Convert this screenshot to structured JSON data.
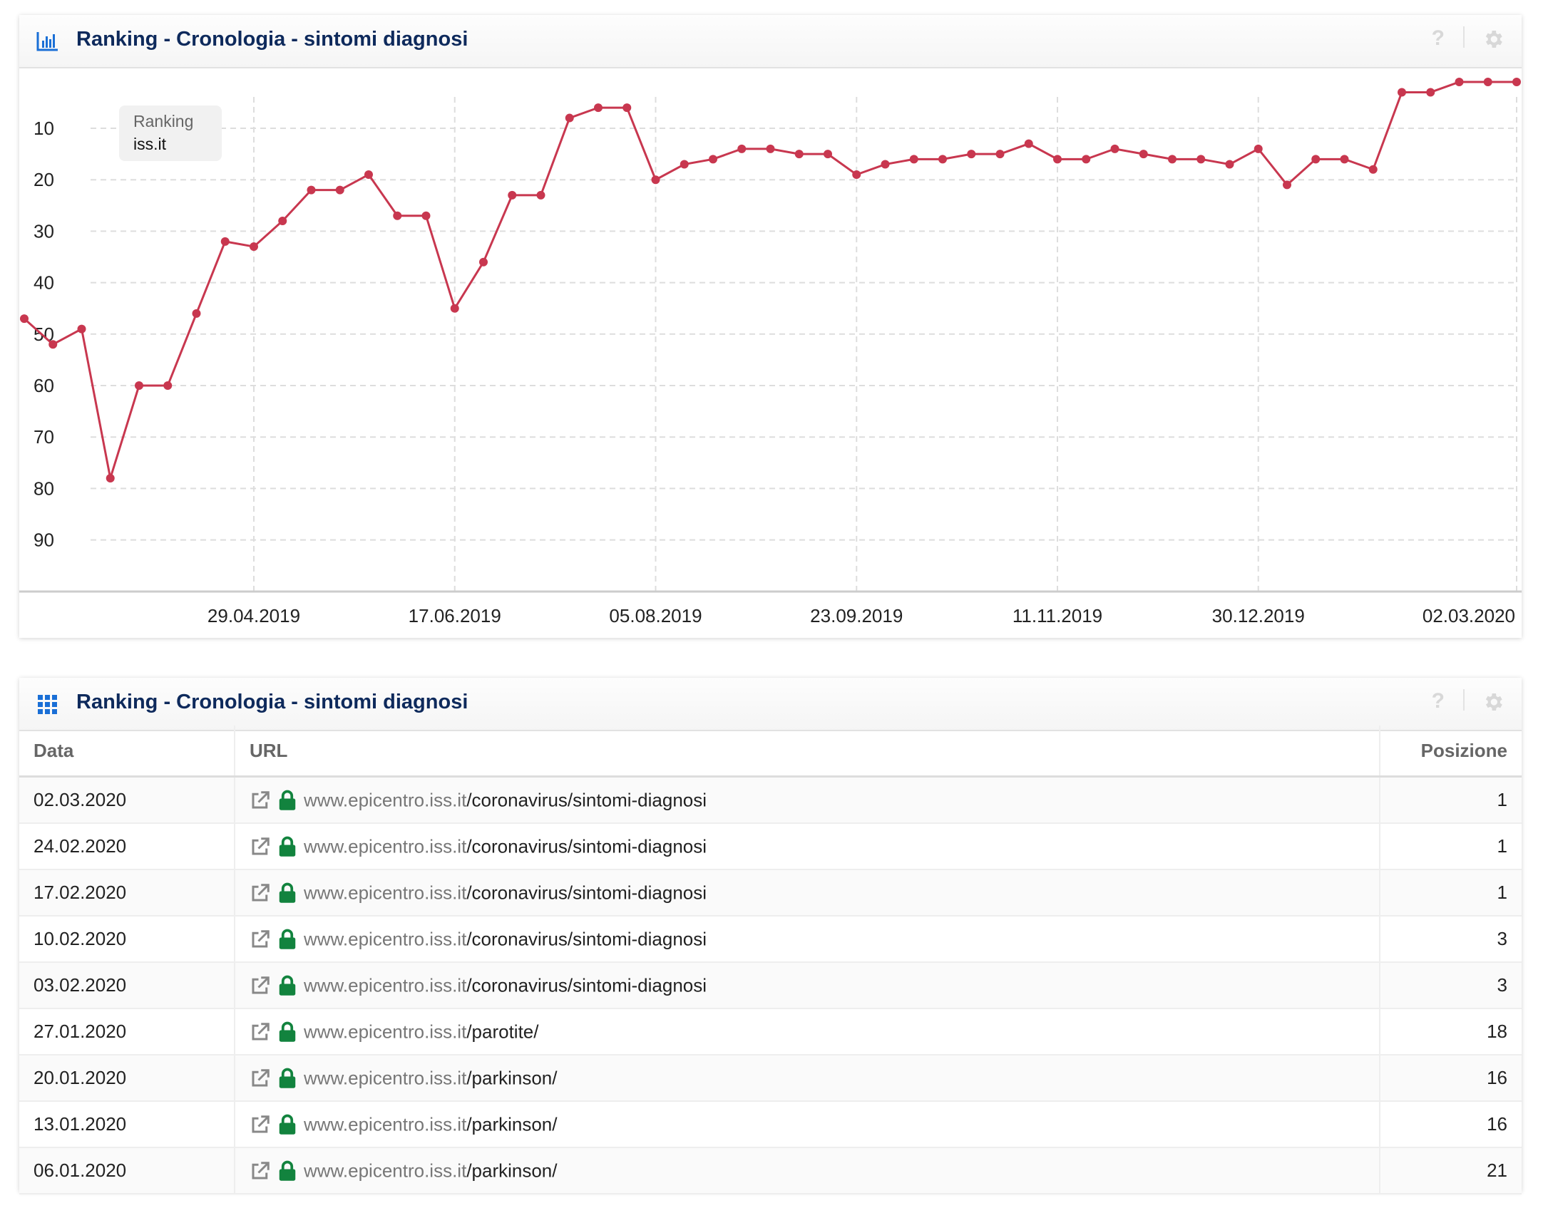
{
  "chart_panel": {
    "title": "Ranking - Cronologia - sintomi diagnosi",
    "icon": "bar-chart-icon",
    "help_label": "?",
    "legend": {
      "line1": "Ranking",
      "line2": "iss.it"
    }
  },
  "chart_data": {
    "type": "line",
    "title": "Ranking - Cronologia - sintomi diagnosi",
    "series": [
      {
        "name": "iss.it",
        "color": "#c8374f",
        "start_date": "04.03.2019",
        "interval": "weekly",
        "values": [
          47,
          52,
          49,
          78,
          60,
          60,
          46,
          32,
          33,
          28,
          22,
          22,
          19,
          27,
          27,
          45,
          36,
          23,
          23,
          8,
          6,
          6,
          20,
          17,
          16,
          14,
          14,
          15,
          15,
          19,
          17,
          16,
          16,
          15,
          15,
          13,
          16,
          16,
          14,
          15,
          16,
          16,
          17,
          14,
          21,
          16,
          16,
          18,
          3,
          3,
          1,
          1,
          1
        ]
      }
    ],
    "x_ticks": [
      "29.04.2019",
      "17.06.2019",
      "05.08.2019",
      "23.09.2019",
      "11.11.2019",
      "30.12.2019",
      "02.03.2020"
    ],
    "y_ticks": [
      10,
      20,
      30,
      40,
      50,
      60,
      70,
      80,
      90
    ],
    "ylim": [
      0,
      100
    ],
    "y_inverted": true,
    "grid": true,
    "legend_placement": "top-left"
  },
  "table_panel": {
    "title": "Ranking - Cronologia - sintomi diagnosi",
    "icon": "grid-icon",
    "help_label": "?",
    "columns": [
      "Data",
      "URL",
      "Posizione"
    ],
    "rows": [
      {
        "date": "02.03.2020",
        "host": "www.epicentro.iss.it",
        "path": "/coronavirus/sintomi-diagnosi",
        "pos": "1"
      },
      {
        "date": "24.02.2020",
        "host": "www.epicentro.iss.it",
        "path": "/coronavirus/sintomi-diagnosi",
        "pos": "1"
      },
      {
        "date": "17.02.2020",
        "host": "www.epicentro.iss.it",
        "path": "/coronavirus/sintomi-diagnosi",
        "pos": "1"
      },
      {
        "date": "10.02.2020",
        "host": "www.epicentro.iss.it",
        "path": "/coronavirus/sintomi-diagnosi",
        "pos": "3"
      },
      {
        "date": "03.02.2020",
        "host": "www.epicentro.iss.it",
        "path": "/coronavirus/sintomi-diagnosi",
        "pos": "3"
      },
      {
        "date": "27.01.2020",
        "host": "www.epicentro.iss.it",
        "path": "/parotite/",
        "pos": "18"
      },
      {
        "date": "20.01.2020",
        "host": "www.epicentro.iss.it",
        "path": "/parkinson/",
        "pos": "16"
      },
      {
        "date": "13.01.2020",
        "host": "www.epicentro.iss.it",
        "path": "/parkinson/",
        "pos": "16"
      },
      {
        "date": "06.01.2020",
        "host": "www.epicentro.iss.it",
        "path": "/parkinson/",
        "pos": "21"
      }
    ]
  },
  "colors": {
    "accent": "#1a6fd6",
    "title": "#0e2a5c",
    "line": "#c8374f",
    "lock": "#12833e"
  }
}
